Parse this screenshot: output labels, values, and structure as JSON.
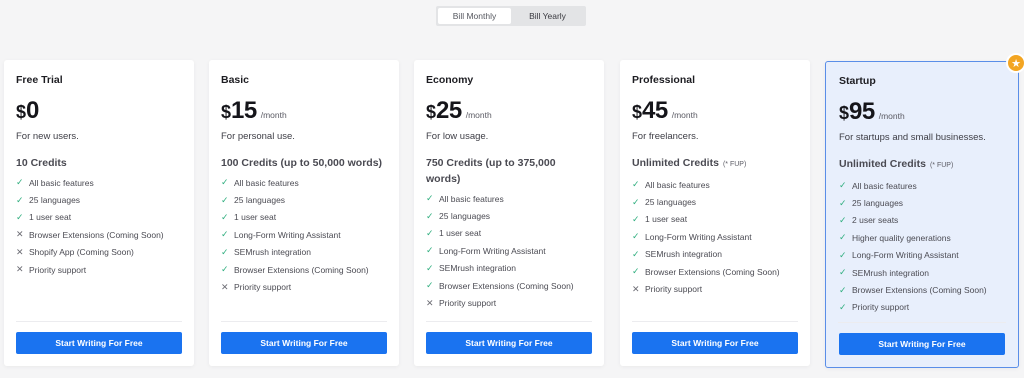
{
  "billing_toggle": {
    "monthly_label": "Bill Monthly",
    "yearly_label": "Bill Yearly",
    "selected": "monthly"
  },
  "colors": {
    "accent": "#1a73f0",
    "check": "#2fae7e",
    "highlight_bg": "#e8effc",
    "highlight_border": "#5a8ee8",
    "badge": "#f3a522"
  },
  "plans": [
    {
      "name": "Free Trial",
      "currency": "$",
      "price": "0",
      "period": "",
      "description": "For new users.",
      "credits": "10 Credits",
      "credits_note": "",
      "features": [
        {
          "text": "All basic features",
          "icon": "check-icon"
        },
        {
          "text": "25 languages",
          "icon": "check-icon"
        },
        {
          "text": "1 user seat",
          "icon": "check-icon"
        },
        {
          "text": "Browser Extensions (Coming Soon)",
          "icon": "cross-icon"
        },
        {
          "text": "Shopify App (Coming Soon)",
          "icon": "cross-icon"
        },
        {
          "text": "Priority support",
          "icon": "cross-icon"
        }
      ],
      "cta": "Start Writing For Free"
    },
    {
      "name": "Basic",
      "currency": "$",
      "price": "15",
      "period": "/month",
      "description": "For personal use.",
      "credits": "100 Credits (up to 50,000 words)",
      "credits_note": "",
      "features": [
        {
          "text": "All basic features",
          "icon": "check-icon"
        },
        {
          "text": "25 languages",
          "icon": "check-icon"
        },
        {
          "text": "1 user seat",
          "icon": "check-icon"
        },
        {
          "text": "Long-Form Writing Assistant",
          "icon": "check-icon"
        },
        {
          "text": "SEMrush integration",
          "icon": "check-icon"
        },
        {
          "text": "Browser Extensions (Coming Soon)",
          "icon": "check-icon"
        },
        {
          "text": "Priority support",
          "icon": "cross-icon"
        }
      ],
      "cta": "Start Writing For Free"
    },
    {
      "name": "Economy",
      "currency": "$",
      "price": "25",
      "period": "/month",
      "description": "For low usage.",
      "credits": "750 Credits (up to 375,000 words)",
      "credits_note": "",
      "features": [
        {
          "text": "All basic features",
          "icon": "check-icon"
        },
        {
          "text": "25 languages",
          "icon": "check-icon"
        },
        {
          "text": "1 user seat",
          "icon": "check-icon"
        },
        {
          "text": "Long-Form Writing Assistant",
          "icon": "check-icon"
        },
        {
          "text": "SEMrush integration",
          "icon": "check-icon"
        },
        {
          "text": "Browser Extensions (Coming Soon)",
          "icon": "check-icon"
        },
        {
          "text": "Priority support",
          "icon": "cross-icon"
        }
      ],
      "cta": "Start Writing For Free"
    },
    {
      "name": "Professional",
      "currency": "$",
      "price": "45",
      "period": "/month",
      "description": "For freelancers.",
      "credits": "Unlimited Credits",
      "credits_note": "(* FUP)",
      "features": [
        {
          "text": "All basic features",
          "icon": "check-icon"
        },
        {
          "text": "25 languages",
          "icon": "check-icon"
        },
        {
          "text": "1 user seat",
          "icon": "check-icon"
        },
        {
          "text": "Long-Form Writing Assistant",
          "icon": "check-icon"
        },
        {
          "text": "SEMrush integration",
          "icon": "check-icon"
        },
        {
          "text": "Browser Extensions (Coming Soon)",
          "icon": "check-icon"
        },
        {
          "text": "Priority support",
          "icon": "cross-icon"
        }
      ],
      "cta": "Start Writing For Free"
    },
    {
      "name": "Startup",
      "currency": "$",
      "price": "95",
      "period": "/month",
      "description": "For startups and small businesses.",
      "credits": "Unlimited Credits",
      "credits_note": "(* FUP)",
      "features": [
        {
          "text": "All basic features",
          "icon": "check-icon"
        },
        {
          "text": "25 languages",
          "icon": "check-icon"
        },
        {
          "text": "2 user seats",
          "icon": "check-icon"
        },
        {
          "text": "Higher quality generations",
          "icon": "check-icon"
        },
        {
          "text": "Long-Form Writing Assistant",
          "icon": "check-icon"
        },
        {
          "text": "SEMrush integration",
          "icon": "check-icon"
        },
        {
          "text": "Browser Extensions (Coming Soon)",
          "icon": "check-icon"
        },
        {
          "text": "Priority support",
          "icon": "check-icon"
        }
      ],
      "cta": "Start Writing For Free",
      "badge_icon": "star-icon"
    }
  ]
}
